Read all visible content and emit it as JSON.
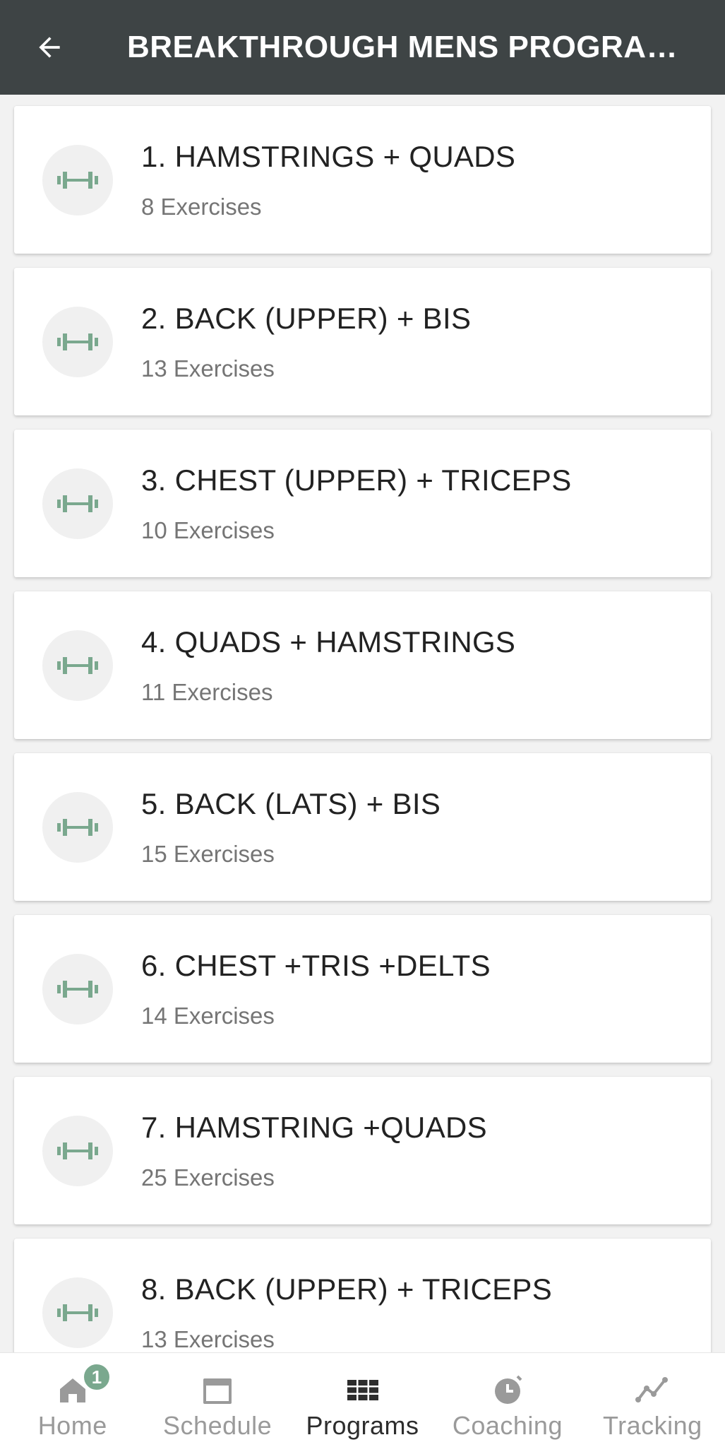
{
  "header": {
    "title": "BREAKTHROUGH MENS PROGRA…",
    "back_icon": "arrow-left-icon"
  },
  "colors": {
    "header_bg": "#3e4445",
    "accent": "#7aa88e",
    "icon_circle": "#f0f0f0"
  },
  "workouts": [
    {
      "title": "1. HAMSTRINGS + QUADS",
      "subtitle": "8 Exercises",
      "icon": "dumbbell-icon"
    },
    {
      "title": "2. BACK (UPPER) + BIS",
      "subtitle": "13 Exercises",
      "icon": "dumbbell-icon"
    },
    {
      "title": "3. CHEST (UPPER) + TRICEPS",
      "subtitle": "10 Exercises",
      "icon": "dumbbell-icon"
    },
    {
      "title": "4. QUADS + HAMSTRINGS",
      "subtitle": "11 Exercises",
      "icon": "dumbbell-icon"
    },
    {
      "title": "5. BACK (LATS) + BIS",
      "subtitle": "15 Exercises",
      "icon": "dumbbell-icon"
    },
    {
      "title": "6. CHEST +TRIS +DELTS",
      "subtitle": "14 Exercises",
      "icon": "dumbbell-icon"
    },
    {
      "title": "7. HAMSTRING +QUADS",
      "subtitle": "25 Exercises",
      "icon": "dumbbell-icon"
    },
    {
      "title": "8. BACK (UPPER) + TRICEPS",
      "subtitle": "13 Exercises",
      "icon": "dumbbell-icon"
    }
  ],
  "bottom_nav": {
    "items": [
      {
        "label": "Home",
        "icon": "home-icon",
        "badge": "1",
        "active": false
      },
      {
        "label": "Schedule",
        "icon": "calendar-icon",
        "active": false
      },
      {
        "label": "Programs",
        "icon": "grid-icon",
        "active": true
      },
      {
        "label": "Coaching",
        "icon": "clock-icon",
        "active": false
      },
      {
        "label": "Tracking",
        "icon": "line-chart-icon",
        "active": false
      }
    ]
  }
}
